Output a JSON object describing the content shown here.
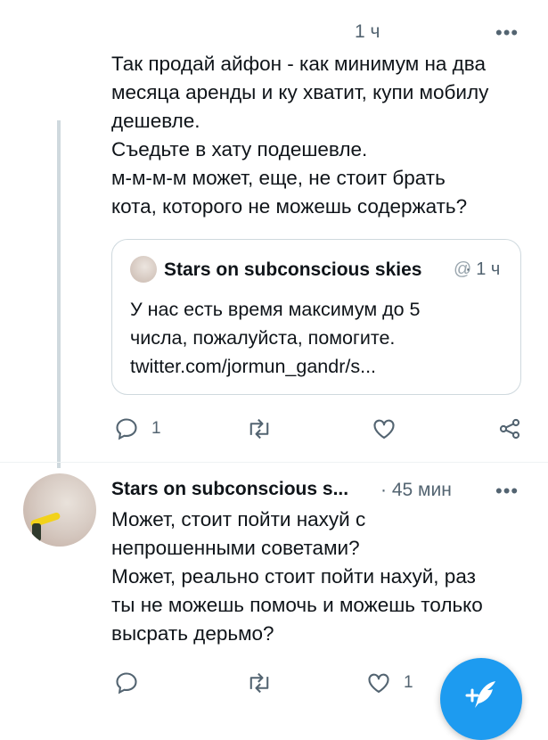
{
  "tweet1": {
    "time": "1 ч",
    "more": "•••",
    "text": "Так продай айфон - как минимум на два\nмесяца аренды и ку хватит, купи мобилу\nдешевле.\nСъедьте в хату подешевле.\nм-м-м-м может, еще, не стоит брать\nкота, которого не можешь содержать?",
    "quote": {
      "author": "Stars on subconscious skies",
      "handle_trunc": "@",
      "time": "· 1 ч",
      "text": "У нас есть время максимум до 5\nчисла, пожалуйста, помогите.\ntwitter.com/jormun_gandr/s..."
    },
    "actions": {
      "reply_count": "1",
      "retweet_count": "",
      "like_count": ""
    }
  },
  "tweet2": {
    "author": "Stars on subconscious s...",
    "time": "· 45 мин",
    "more": "•••",
    "text": "Может, стоит пойти нахуй с\nнепрошенными советами?\nМожет, реально стоит пойти нахуй, раз\nты не можешь помочь и можешь только\nвысрать дерьмо?",
    "actions": {
      "reply_count": "",
      "retweet_count": "",
      "like_count": "1"
    }
  },
  "fab": {
    "icon": "compose-tweet-icon"
  },
  "colors": {
    "accent": "#1d9bf0",
    "muted": "#536471",
    "border": "#cfd9de"
  }
}
